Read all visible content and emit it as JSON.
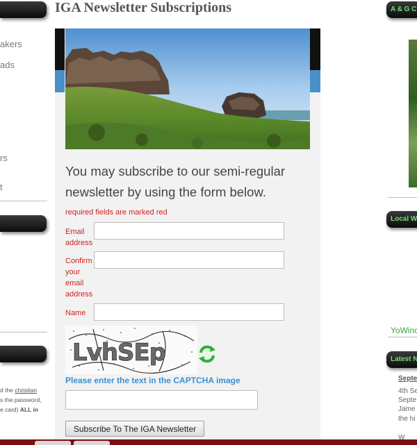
{
  "page": {
    "title": "IGA Newsletter Subscriptions"
  },
  "left_sidebar": {
    "links": [
      "akers",
      "ads",
      "rs"
    ],
    "marker": "t",
    "footer_text": {
      "line1_prefix": "d the ",
      "line1_link": "christian",
      "line2": "s the password,",
      "line3_prefix": "e card) ",
      "line3_bold": "ALL in"
    }
  },
  "form": {
    "intro": "You may subscribe to our semi-regular newsletter by using the form below.",
    "required_note": "required fields are marked red",
    "email_label": "Email address",
    "email_value": "",
    "confirm_email_label": "Confirm your email address",
    "confirm_email_value": "",
    "name_label": "Name",
    "name_value": "",
    "captcha_text": "LvhSEp",
    "captcha_prompt": "Please enter the text in the CAPTCHA image",
    "captcha_value": "",
    "submit_label": "Subscribe To The IGA Newsletter"
  },
  "right_sidebar": {
    "tab1": "A & G C",
    "tab2": "Local W",
    "tab3": "Latest N",
    "green_text": "YoWinc",
    "news": {
      "date": "Septe",
      "lines": [
        "4th Se",
        "Septe",
        "Jame",
        "the hi"
      ],
      "trailing": "W"
    }
  },
  "colors": {
    "required_red": "#d32020",
    "link_blue": "#3b8fcf",
    "sidebar_green": "#6fe07a",
    "panel_gray": "#f2f2f2"
  }
}
